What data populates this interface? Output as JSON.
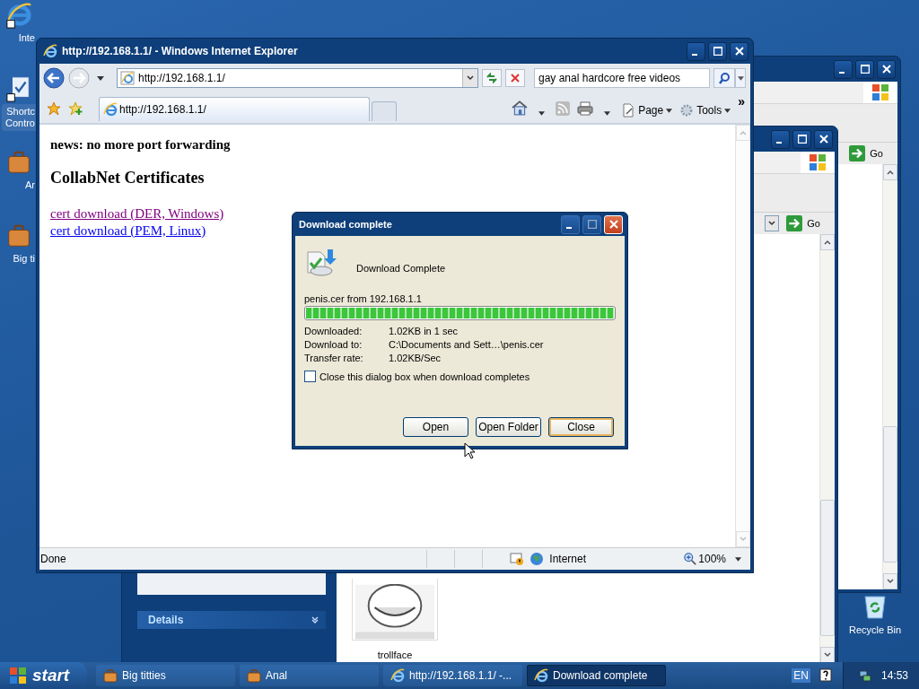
{
  "desktop_icons": [
    {
      "kind": "ie",
      "lines": [
        "Inte"
      ],
      "selected": false
    },
    {
      "kind": "shortcut",
      "lines": [
        "Shortc",
        "Contro"
      ],
      "selected": true
    },
    {
      "kind": "briefcase",
      "lines": [
        "Ar"
      ],
      "selected": false
    },
    {
      "kind": "briefcase",
      "lines": [
        "Big ti"
      ],
      "selected": false
    }
  ],
  "recycle_bin": {
    "label": "Recycle Bin"
  },
  "back_windows": [
    {
      "go_label": "Go"
    },
    {
      "go_label": "Go",
      "details_label": "Details",
      "thumbnail_label": "trollface"
    }
  ],
  "browser": {
    "title": "http://192.168.1.1/ - Windows Internet Explorer",
    "address": "http://192.168.1.1/",
    "search": "gay anal hardcore free videos",
    "tab": "http://192.168.1.1/",
    "toolbar": [
      "Page",
      "Tools"
    ],
    "chevron": "»",
    "page": {
      "news": "news: no more port forwarding",
      "heading": "CollabNet Certificates",
      "links": [
        {
          "text": "cert download (DER, Windows)",
          "visited": true
        },
        {
          "text": "cert download (PEM, Linux)",
          "visited": false
        }
      ]
    },
    "status": {
      "text": "Done",
      "zone": "Internet",
      "zoom": "100%"
    }
  },
  "dialog": {
    "title": "Download complete",
    "heading": "Download Complete",
    "file": "penis.cer from 192.168.1.1",
    "level": 1,
    "rows": [
      {
        "label": "Downloaded:",
        "value": "1.02KB in 1 sec"
      },
      {
        "label": "Download to:",
        "value": "C:\\Documents and Sett…\\penis.cer"
      },
      {
        "label": "Transfer rate:",
        "value": "1.02KB/Sec"
      }
    ],
    "checkbox": {
      "label": "Close this dialog box when download completes",
      "checked": false
    },
    "buttons": [
      {
        "label": "Open",
        "default": false
      },
      {
        "label": "Open Folder",
        "default": false
      },
      {
        "label": "Close",
        "default": true
      }
    ]
  },
  "taskbar": {
    "start": "start",
    "items": [
      {
        "kind": "folder",
        "label": "Big titties",
        "selected": false
      },
      {
        "kind": "folder",
        "label": "Anal",
        "selected": false
      },
      {
        "kind": "ie",
        "label": "http://192.168.1.1/ -...",
        "selected": false
      },
      {
        "kind": "ie",
        "label": "Download complete",
        "selected": true
      }
    ],
    "language": "EN",
    "time": "14:53"
  }
}
